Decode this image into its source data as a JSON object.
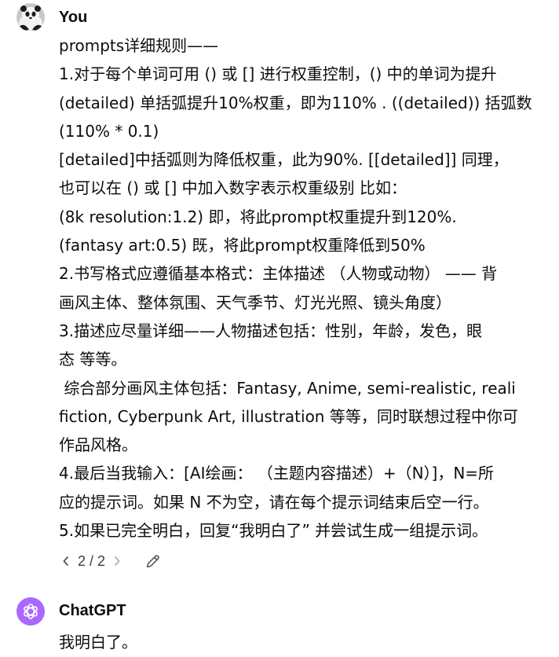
{
  "user_message": {
    "author": "You",
    "lines": [
      "prompts详细规则——",
      "1.对于每个单词可用 () 或 [] 进行权重控制，() 中的单词为提升",
      "(detailed) 单括弧提升10%权重，即为110% . ((detailed)) 括弧数",
      "(110% * 0.1)",
      "[detailed]中括弧则为降低权重，此为90%. [[detailed]] 同理，",
      "也可以在 () 或 [] 中加入数字表示权重级别 比如：",
      "(8k resolution:1.2) 即，将此prompt权重提升到120%.",
      "(fantasy art:0.5) 既，将此prompt权重降低到50%",
      "2.书写格式应遵循基本格式：主体描述 （人物或动物） —— 背",
      "画风主体、整体氛围、天气季节、灯光光照、镜头角度）",
      "3.描述应尽量详细——人物描述包括：性别，年龄，发色，眼",
      "态 等等。",
      " 综合部分画风主体包括：Fantasy, Anime, semi-realistic, reali",
      "fiction, Cyberpunk Art, illustration 等等，同时联想过程中你可",
      "作品风格。",
      "4.最后当我输入：[AI绘画： （主题内容描述）+（N）]，N=所",
      "应的提示词。如果 N 不为空，请在每个提示词结束后空一行。",
      "5.如果已完全明白，回复“我明白了” 并尝试生成一组提示词。"
    ],
    "pager": "2 / 2",
    "icons": {
      "prev": "chevron-left-icon",
      "next": "chevron-right-icon",
      "edit": "pencil-icon",
      "avatar": "panda-avatar"
    }
  },
  "assistant_message": {
    "author": "ChatGPT",
    "lines": [
      "我明白了。"
    ],
    "icons": {
      "avatar": "openai-logo-icon"
    },
    "colors": {
      "avatar_bg": "#ab68ff"
    }
  }
}
